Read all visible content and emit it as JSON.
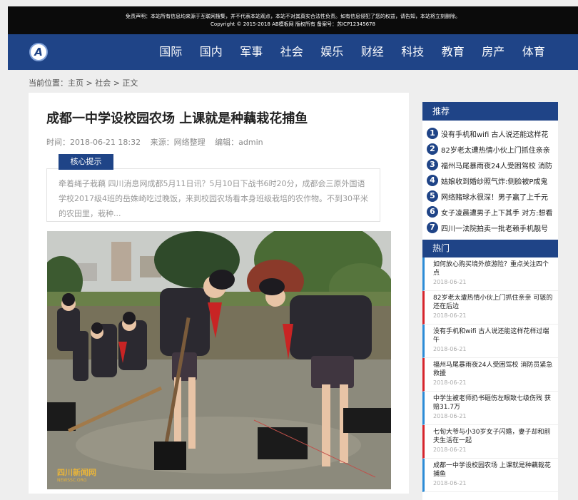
{
  "header": {
    "disclaimer": "免责声明：本站所有信息均来源于互联网搜集，并不代表本站观点，本站不对其真实合法性负责。如有信息侵犯了您的权益，请告知，本站将立刻删除。",
    "copyright": "Copyright © 2015-2018 AB模板网 版权所有  备案号：苏ICP12345678"
  },
  "nav": {
    "logo_letter": "A",
    "items": [
      "国际",
      "国内",
      "军事",
      "社会",
      "娱乐",
      "财经",
      "科技",
      "教育",
      "房产",
      "体育"
    ]
  },
  "breadcrumb": "当前位置：主页 > 社会 > 正文",
  "article": {
    "title": "成都一中学设校园农场 上课就是种藕栽花捕鱼",
    "time": "时间：2018-06-21 18:32",
    "source": "来源：网络整理",
    "editor": "编辑：admin",
    "tip_label": "核心提示",
    "summary": "牵着绳子栽藕 四川消息网成都5月11日讯？5月10日下战书6时20分，成都会三原外国语学校2017级4班的岳姝崎吃过晚饭，来到校园农场看本身班级栽培的农作物。不到30平米的农田里，栽种...",
    "watermark": "四川新闻网",
    "watermark_sub": "NEWSSC.ORG"
  },
  "sidebar": {
    "rec_title": "推荐",
    "rec_items": [
      {
        "num": "1",
        "text": "没有手机和wifi 古人说还能这样花"
      },
      {
        "num": "2",
        "text": "82岁老太遭热情小伙上门抓住亲亲"
      },
      {
        "num": "3",
        "text": "福州马尾暴雨夜24人受困驾校 消防"
      },
      {
        "num": "4",
        "text": "姑娘收到婚纱照气炸:侧脸被P成鬼"
      },
      {
        "num": "5",
        "text": "网络赌球水很深！男子赢了上千元"
      },
      {
        "num": "6",
        "text": "女子凌晨遭男子上下其手 对方:想看"
      },
      {
        "num": "7",
        "text": "四川一法院拍卖一批老赖手机靓号"
      }
    ],
    "hot_title": "热门",
    "hot_items": [
      {
        "text": "如何放心购买境外旅游险？重点关注四个点",
        "date": "2018-06-21"
      },
      {
        "text": "82岁老太遭热情小伙上门抓住亲亲 可骇的还在后边",
        "date": "2018-06-21"
      },
      {
        "text": "没有手机和wifi 古人说还能这样花样过端午",
        "date": "2018-06-21"
      },
      {
        "text": "福州马尾暴雨夜24人受困驾校 消防员紧急救援",
        "date": "2018-06-21"
      },
      {
        "text": "中学生被老师扔书砸伤左眼致七级伤残 获赔31.7万",
        "date": "2018-06-21"
      },
      {
        "text": "七旬大爷与小30岁女子闪婚，妻子却和前夫生活在一起",
        "date": "2018-06-21"
      },
      {
        "text": "成都一中学设校园农场 上课就是种藕栽花捕鱼",
        "date": "2018-06-21"
      }
    ]
  },
  "colors": {
    "brand": "#1f4487",
    "hot_blue": "#2b8bd6",
    "hot_red": "#d6242c"
  }
}
